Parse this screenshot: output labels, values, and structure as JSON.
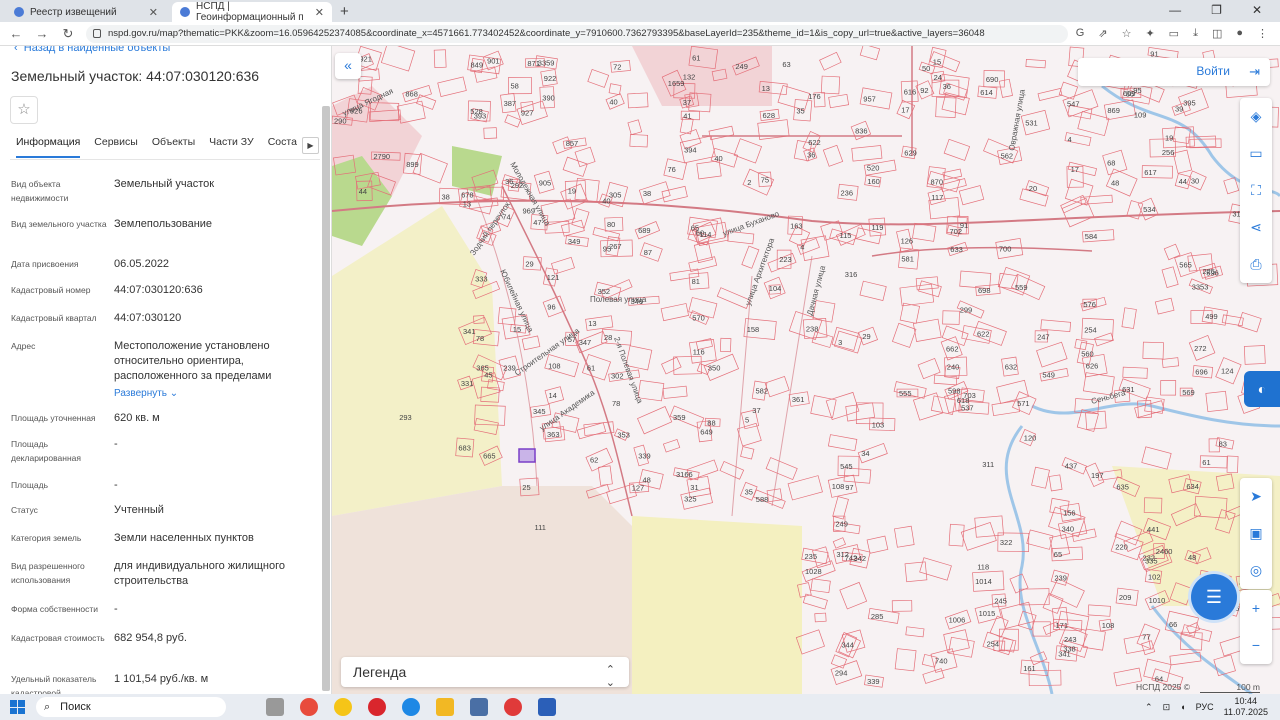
{
  "browser": {
    "tabs": [
      {
        "title": "Реестр извещений"
      },
      {
        "title": "НСПД | Геоинформационный п"
      }
    ],
    "new_tab": "+",
    "url": "nspd.gov.ru/map?thematic=PKK&zoom=16.05964252374085&coordinate_x=4571661.773402452&coordinate_y=7910600.7362793395&baseLayerId=235&theme_id=1&is_copy_url=true&active_layers=36048"
  },
  "panel": {
    "back_label": "Назад в найденные объекты",
    "title": "Земельный участок: 44:07:030120:636",
    "tabs": [
      "Информация",
      "Сервисы",
      "Объекты",
      "Части ЗУ",
      "Соста"
    ],
    "fields": [
      {
        "key": "Вид объекта недвижимости",
        "value": "Земельный участок"
      },
      {
        "key": "Вид земельного участка",
        "value": "Землепользование"
      },
      {
        "key": "Дата присвоения",
        "value": "06.05.2022"
      },
      {
        "key": "Кадастровый номер",
        "value": "44:07:030120:636"
      },
      {
        "key": "Кадастровый квартал",
        "value": "44:07:030120"
      },
      {
        "key": "Адрес",
        "value": "Местоположение установлено относительно ориентира, расположенного за пределами",
        "more": "Развернуть"
      },
      {
        "key": "Площадь уточненная",
        "value": "620 кв. м"
      },
      {
        "key": "Площадь декларированная",
        "value": "-"
      },
      {
        "key": "Площадь",
        "value": "-"
      },
      {
        "key": "Статус",
        "value": "Учтенный"
      },
      {
        "key": "Категория земель",
        "value": "Земли населенных пунктов"
      },
      {
        "key": "Вид разрешенного использования",
        "value": "для индивидуального жилищного строительства"
      },
      {
        "key": "Форма собственности",
        "value": "-"
      },
      {
        "key": "Кадастровая стоимость",
        "value": "682 954,8 руб."
      },
      {
        "key": "Удельный показатель кадастровой",
        "value": "1 101,54 руб./кв. м"
      }
    ]
  },
  "map": {
    "login_label": "Войти",
    "legend_label": "Легенда",
    "copyright": "НСПД 2025 ©",
    "scale_label": "100 m",
    "streets": [
      {
        "name": "улица Ягодная"
      },
      {
        "name": "Молодежная улица"
      },
      {
        "name": "Зодчий переулок"
      },
      {
        "name": "Юбилейная улица"
      },
      {
        "name": "Строительная улица"
      },
      {
        "name": "Полевая улица"
      },
      {
        "name": "2-я Полевая улица"
      },
      {
        "name": "улица Академика"
      },
      {
        "name": "улица Буханово"
      },
      {
        "name": "улица Архитектора"
      },
      {
        "name": "Дачная улица"
      },
      {
        "name": "Овражная улица"
      },
      {
        "name": "Сеньбега"
      }
    ],
    "parcel_labels": [
      "3359",
      "390",
      "387",
      "44",
      "927",
      "393",
      "857",
      "905",
      "921",
      "901",
      "868",
      "871",
      "528",
      "849",
      "926",
      "922",
      "899",
      "72",
      "2790",
      "305",
      "19",
      "40",
      "38",
      "58",
      "290",
      "292",
      "35",
      "36",
      "37",
      "13",
      "75",
      "76",
      "520",
      "41",
      "40",
      "61",
      "1659",
      "957",
      "160",
      "622",
      "628",
      "249",
      "236",
      "836",
      "2",
      "394",
      "395",
      "4",
      "39",
      "531",
      "1",
      "68",
      "534",
      "869",
      "535",
      "870",
      "609",
      "892",
      "547",
      "562",
      "614",
      "616",
      "617",
      "117",
      "690",
      "629",
      "19",
      "30",
      "92",
      "91",
      "3168",
      "15",
      "36",
      "44",
      "20",
      "23",
      "17",
      "24",
      "48",
      "95",
      "50",
      "36",
      "17",
      "331",
      "333",
      "683",
      "239",
      "665",
      "678",
      "689",
      "267",
      "339",
      "40",
      "13",
      "121",
      "25",
      "353",
      "346",
      "347",
      "345",
      "78",
      "80",
      "96",
      "95",
      "47",
      "29",
      "48",
      "57",
      "365",
      "349",
      "363",
      "38",
      "15",
      "74",
      "13",
      "108",
      "127",
      "61",
      "36",
      "341",
      "352",
      "45",
      "14",
      "302",
      "28",
      "62",
      "87",
      "34",
      "35",
      "31",
      "3",
      "4",
      "5",
      "65",
      "88",
      "361",
      "325",
      "60",
      "104",
      "29",
      "350",
      "359",
      "649",
      "3166",
      "81",
      "119",
      "114",
      "115",
      "103",
      "108",
      "163",
      "238",
      "158",
      "582",
      "570",
      "545",
      "588",
      "223",
      "116",
      "91",
      "560",
      "555",
      "559",
      "576",
      "552",
      "565",
      "662",
      "299",
      "254",
      "499",
      "3353",
      "126",
      "124",
      "240",
      "247",
      "549",
      "571",
      "596",
      "581",
      "537",
      "626",
      "598",
      "622",
      "618",
      "584",
      "225",
      "272",
      "569",
      "709",
      "698",
      "700",
      "702",
      "703",
      "696",
      "631",
      "632",
      "633",
      "634",
      "635",
      "636",
      "340",
      "341",
      "64",
      "338",
      "66",
      "335",
      "83",
      "59",
      "2460",
      "48",
      "65",
      "77",
      "156",
      "441",
      "232",
      "161",
      "197",
      "421",
      "239",
      "220",
      "437",
      "209",
      "305",
      "108",
      "120",
      "243",
      "78",
      "102",
      "61",
      "171",
      "1010",
      "322",
      "245",
      "254",
      "235",
      "342",
      "339",
      "294",
      "1028",
      "285",
      "249",
      "742",
      "344",
      "740",
      "1014",
      "1015",
      "1006",
      "312",
      "311",
      "969",
      "256",
      "316",
      "63",
      "37",
      "293",
      "109",
      "111",
      "97",
      "118",
      "176",
      "132",
      "78"
    ]
  }
}
